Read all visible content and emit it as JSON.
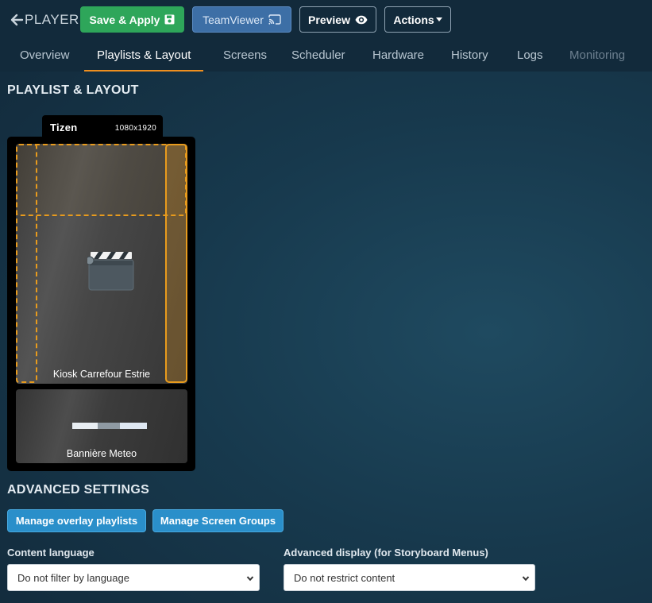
{
  "header": {
    "back_label": "PLAYER",
    "buttons": {
      "save_apply": "Save & Apply",
      "teamviewer": "TeamViewer",
      "preview": "Preview",
      "actions": "Actions"
    },
    "tabs": [
      {
        "label": "Overview"
      },
      {
        "label": "Playlists & Layout"
      },
      {
        "label": "Screens"
      },
      {
        "label": "Scheduler"
      },
      {
        "label": "Hardware"
      },
      {
        "label": "History"
      },
      {
        "label": "Logs"
      },
      {
        "label": "Monitoring"
      }
    ],
    "active_tab": "Playlists & Layout",
    "disabled_tab": "Monitoring"
  },
  "playlist_layout": {
    "title": "PLAYLIST & LAYOUT",
    "device": {
      "name": "Tizen",
      "resolution": "1080x1920"
    },
    "zones": [
      {
        "label": "Kiosk Carrefour Estrie",
        "icon": "clapperboard-icon"
      },
      {
        "label": "Bannière Meteo"
      }
    ],
    "overlay_color": "#e89b1d"
  },
  "advanced": {
    "title": "ADVANCED SETTINGS",
    "manage_overlay": "Manage overlay playlists",
    "manage_groups": "Manage Screen Groups",
    "content_language": {
      "label": "Content language",
      "value": "Do not filter by language"
    },
    "advanced_display": {
      "label": "Advanced display (for Storyboard Menus)",
      "value": "Do not restrict content"
    }
  },
  "colors": {
    "accent": "#ef8f1f",
    "save": "#2ea65a",
    "primary": "#2a8fca"
  }
}
